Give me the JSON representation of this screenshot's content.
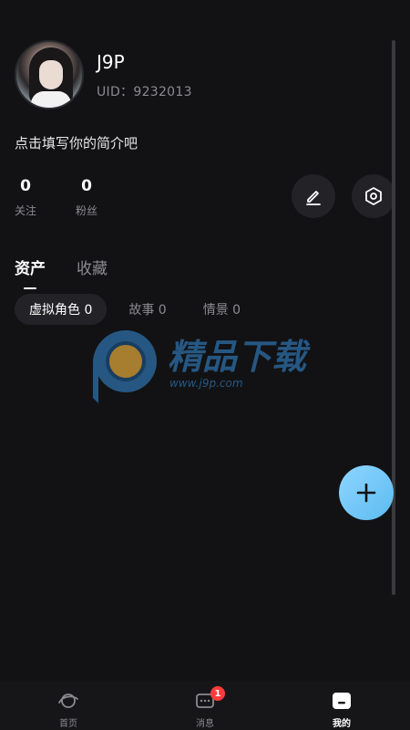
{
  "profile": {
    "name": "J9P",
    "uid": "UID：9232013",
    "bio": "点击填写你的简介吧"
  },
  "stats": [
    {
      "value": "0",
      "label": "关注"
    },
    {
      "value": "0",
      "label": "粉丝"
    }
  ],
  "actions": {
    "edit_icon": "pencil-icon",
    "settings_icon": "gear-hex-icon"
  },
  "tabs": [
    {
      "label": "资产",
      "active": true
    },
    {
      "label": "收藏",
      "active": false
    }
  ],
  "chips": [
    {
      "label": "虚拟角色 0",
      "active": true
    },
    {
      "label": "故事 0",
      "active": false
    },
    {
      "label": "情景 0",
      "active": false
    }
  ],
  "watermark": {
    "brand": "精品下载",
    "url": "www.j9p.com"
  },
  "fab": {
    "icon": "plus-icon"
  },
  "bottom_nav": [
    {
      "label": "首页",
      "icon": "planet-icon",
      "active": false
    },
    {
      "label": "消息",
      "icon": "message-icon",
      "active": false,
      "badge": "1"
    },
    {
      "label": "我的",
      "icon": "profile-icon",
      "active": true
    }
  ],
  "colors": {
    "background": "#121214",
    "surface": "#232327",
    "fab": "#5bbbf0",
    "badge": "#ff3b3b"
  }
}
